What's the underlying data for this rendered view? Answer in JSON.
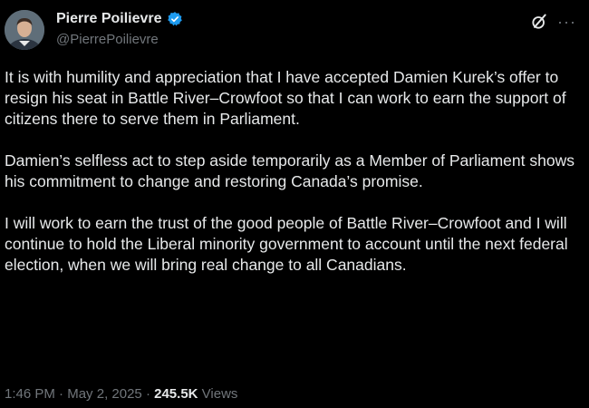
{
  "author": {
    "name": "Pierre Poilievre",
    "handle": "@PierrePoilievre",
    "verified": true
  },
  "icons": {
    "verified": "verified-badge-icon",
    "grok": "grok-icon",
    "more": "more-icon"
  },
  "tweet": {
    "paragraphs": [
      "It is with humility and appreciation that I have accepted Damien Kurek’s offer to resign his seat in Battle River–Crowfoot so that I can work to earn the support of citizens there to serve them in Parliament.",
      "Damien’s selfless act to step aside temporarily as a Member of Parliament shows his commitment to change and restoring Canada’s promise.",
      "I will work to earn the trust of the good people of Battle River–Crowfoot and I will continue to hold the Liberal minority government to account until the next federal election, when we will bring real change to all Canadians."
    ]
  },
  "meta": {
    "time": "1:46 PM",
    "separator": " · ",
    "date": "May 2, 2025",
    "views_count": "245.5K",
    "views_label": " Views"
  },
  "colors": {
    "background": "#000000",
    "text": "#e7e9ea",
    "secondary": "#71767b",
    "verified": "#1d9bf0"
  }
}
